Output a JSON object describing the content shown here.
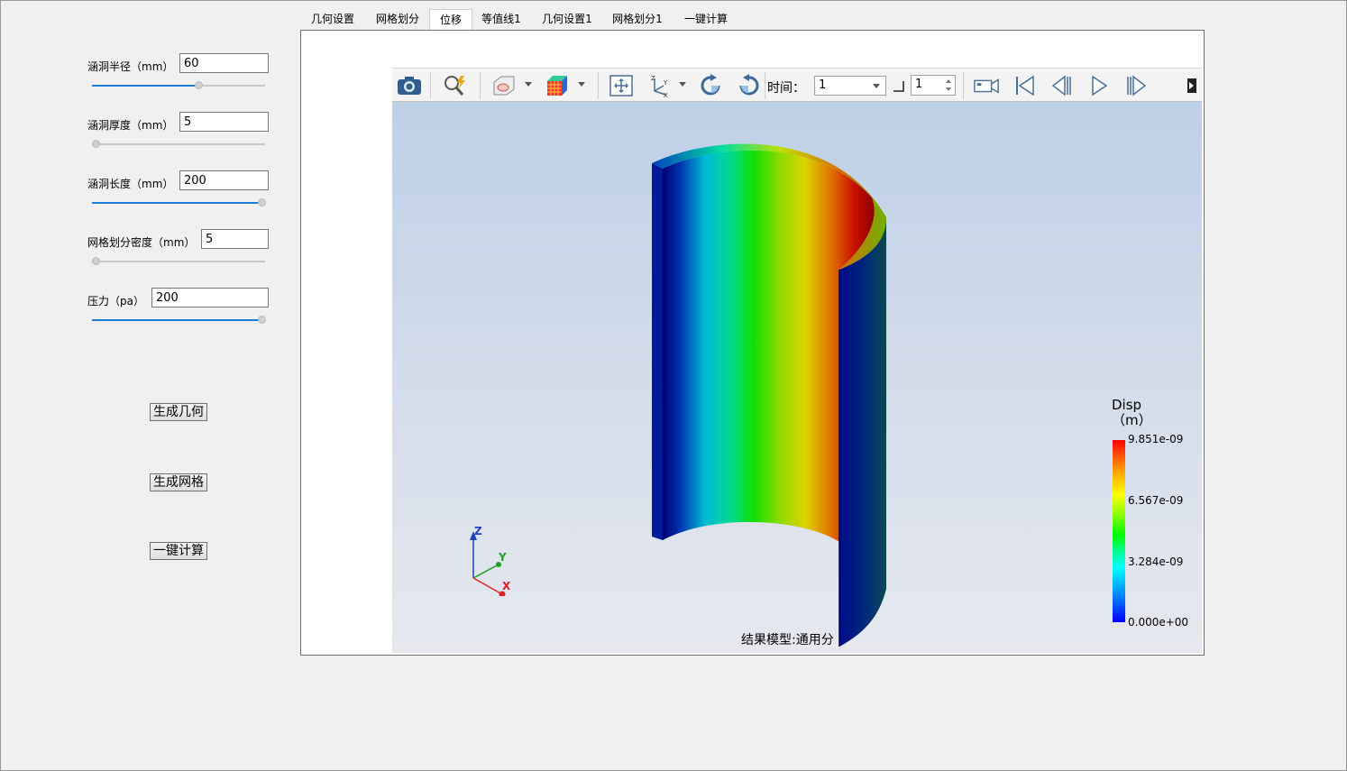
{
  "params": [
    {
      "label": "涵洞半径（mm）",
      "value": "60",
      "slider": 0.61
    },
    {
      "label": "涵洞厚度（mm）",
      "value": "5",
      "slider": 0.03
    },
    {
      "label": "涵洞长度（mm）",
      "value": "200",
      "slider": 1.0
    },
    {
      "label": "网格划分密度（mm）",
      "value": "5",
      "slider": 0.03
    },
    {
      "label": "压力（pa）",
      "value": "200",
      "slider": 1.0
    }
  ],
  "buttons": {
    "generate_geometry": "生成几何",
    "generate_mesh": "生成网格",
    "one_click_compute": "一键计算"
  },
  "tabs": [
    "几何设置",
    "网格划分",
    "位移",
    "等值线1",
    "几何设置1",
    "网格划分1",
    "一键计算"
  ],
  "active_tab": "位移",
  "toolbar": {
    "time_label": "时间：",
    "time_value": "1",
    "step_value": "1",
    "icons": [
      "camera-icon",
      "zoom-fit-icon",
      "section-view-icon",
      "color-cube-icon",
      "fit-view-icon",
      "axes-icon",
      "rotate-cw-icon",
      "rotate-ccw-icon",
      "video-record-icon",
      "first-frame-icon",
      "prev-frame-icon",
      "play-icon",
      "next-frame-icon",
      "more-icon"
    ]
  },
  "legend": {
    "title": "Disp\n（m）",
    "ticks": [
      "9.851e-09",
      "6.567e-09",
      "3.284e-09",
      "0.000e+00"
    ]
  },
  "axes": {
    "x": "X",
    "y": "Y",
    "z": "Z"
  },
  "status": "结果模型:通用分"
}
